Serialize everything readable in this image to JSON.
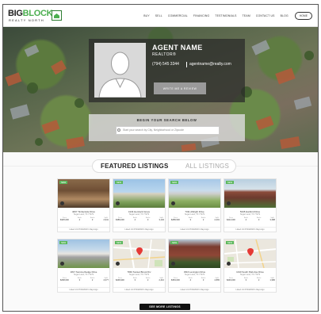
{
  "brand": {
    "name_part1": "BIG",
    "name_part2": "BLOCK",
    "tagline": "REALTY NORTH"
  },
  "nav": {
    "items": [
      "BUY",
      "SELL",
      "COMMERCIAL",
      "FINANCING",
      "TESTIMONIALS",
      "TEAM",
      "CONTACT US",
      "BLOG"
    ],
    "home": "HOME"
  },
  "agent": {
    "name": "AGENT NAME",
    "title": "REALTOR®",
    "phone": "(794) 545 3344",
    "email": "agentname@realty.com",
    "review_button": "WRITE ME A REVIEW"
  },
  "search": {
    "title": "BEGIN YOUR SEARCH BELOW",
    "placeholder": "Start your search by City, Neighborhood or Zipcode"
  },
  "tabs": {
    "featured": "FEATURED LISTINGS",
    "all": "ALL LISTINGS"
  },
  "listings": [
    {
      "badge": "NEW",
      "address": "4067 Timberside Drive",
      "city": "Sugar Land, TX 77479",
      "price": "$325,000",
      "beds": "4",
      "baths": "3",
      "sqft": "2,941",
      "listed": "Listed 1/1 07/04/2018 1 Days Ago"
    },
    {
      "badge": "NEW",
      "address": "4134 Hemlock Grove",
      "city": "Sugar Land, TX 77479",
      "price": "$389,000",
      "beds": "4",
      "baths": "3",
      "sqft": "3,102",
      "listed": "Listed 1/1 07/04/2018 1 Days Ago"
    },
    {
      "badge": "NEW",
      "address": "7311 Albright Drive",
      "city": "Sugar Land, TX 77479",
      "price": "$289,500",
      "beds": "3",
      "baths": "2",
      "sqft": "2,201",
      "listed": "Listed 1/1 07/04/2018 1 Days Ago"
    },
    {
      "badge": "NEW",
      "address": "5345 Hartford Drive",
      "city": "Sugar Land, TX 77479",
      "price": "$412,000",
      "beds": "4",
      "baths": "3",
      "sqft": "3,388",
      "listed": "Listed 1/1 07/04/2018 1 Days Ago"
    },
    {
      "badge": "NEW",
      "address": "1817 Summerhedge Drive",
      "city": "Sugar Land, TX 77479",
      "price": "$268,000",
      "beds": "3",
      "baths": "2",
      "sqft": "2,077",
      "listed": "Listed 1/1 07/04/2018 1 Days Ago"
    },
    {
      "badge": "NEW",
      "address": "7846 Sunset Brook Drv",
      "city": "Sugar Land, TX 77479",
      "price": "$299,900",
      "beds": "3",
      "baths": "2",
      "sqft": "2,410",
      "listed": "Listed 1/1 07/04/2018 1 Days Ago"
    },
    {
      "badge": "NEW",
      "address": "3316 Lexington Drive",
      "city": "Sugar Land, TX 77479",
      "price": "$354,000",
      "beds": "4",
      "baths": "3",
      "sqft": "2,865",
      "listed": "Listed 1/1 07/04/2018 1 Days Ago"
    },
    {
      "badge": "NEW",
      "address": "1010 South Park Ave Drive",
      "city": "Sugar Land, TX 77479",
      "price": "$249,000",
      "beds": "3",
      "baths": "2",
      "sqft": "1,980",
      "listed": "Listed 1/1 07/04/2018 1 Days Ago"
    }
  ],
  "stat_labels": {
    "price": "Price",
    "beds": "Beds",
    "baths": "Baths",
    "sqft": "SqFt"
  },
  "see_more": "SEE MORE LISTINGS",
  "colors": {
    "accent": "#5cb85c",
    "dark": "#111111"
  }
}
